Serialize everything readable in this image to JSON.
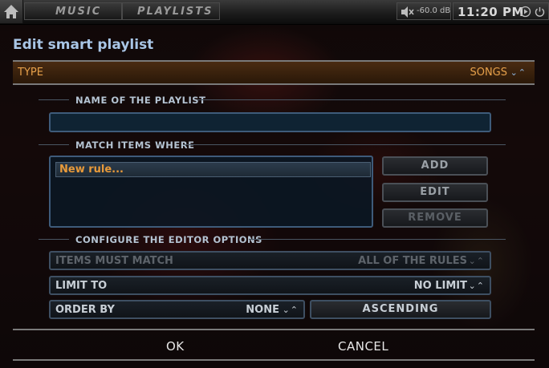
{
  "topbar": {
    "home_icon": "home-icon",
    "breadcrumbs": [
      "MUSIC",
      "PLAYLISTS"
    ],
    "volume": "-60.0 dB",
    "mute_icon": "mute-speaker-icon",
    "time": "11:20 PM",
    "play_icon": "play-icon",
    "power_icon": "power-icon"
  },
  "dialog": {
    "title": "Edit smart playlist",
    "type": {
      "label": "TYPE",
      "value": "SONGS",
      "spinner": "⌄⌃"
    },
    "name_section": {
      "header": "NAME OF THE PLAYLIST",
      "input_value": ""
    },
    "match_section": {
      "header": "MATCH ITEMS WHERE",
      "rules": [
        "New rule..."
      ],
      "buttons": {
        "add": "ADD",
        "edit": "EDIT",
        "remove": "REMOVE"
      }
    },
    "options_section": {
      "header": "CONFIGURE THE EDITOR OPTIONS",
      "items_must_match": {
        "label": "ITEMS MUST MATCH",
        "value": "ALL OF THE RULES",
        "spinner": "⌄⌃"
      },
      "limit_to": {
        "label": "LIMIT TO",
        "value": "NO LIMIT",
        "spinner": "⌄⌃"
      },
      "order_by": {
        "label": "ORDER BY",
        "value": "NONE",
        "spinner": "⌄⌃"
      },
      "sort_direction": "ASCENDING"
    },
    "actions": {
      "ok": "OK",
      "cancel": "CANCEL"
    }
  },
  "colors": {
    "accent_orange": "#e6a04a",
    "heading_blue": "#a9c6e6",
    "frame_blue": "#3e5b7a"
  }
}
